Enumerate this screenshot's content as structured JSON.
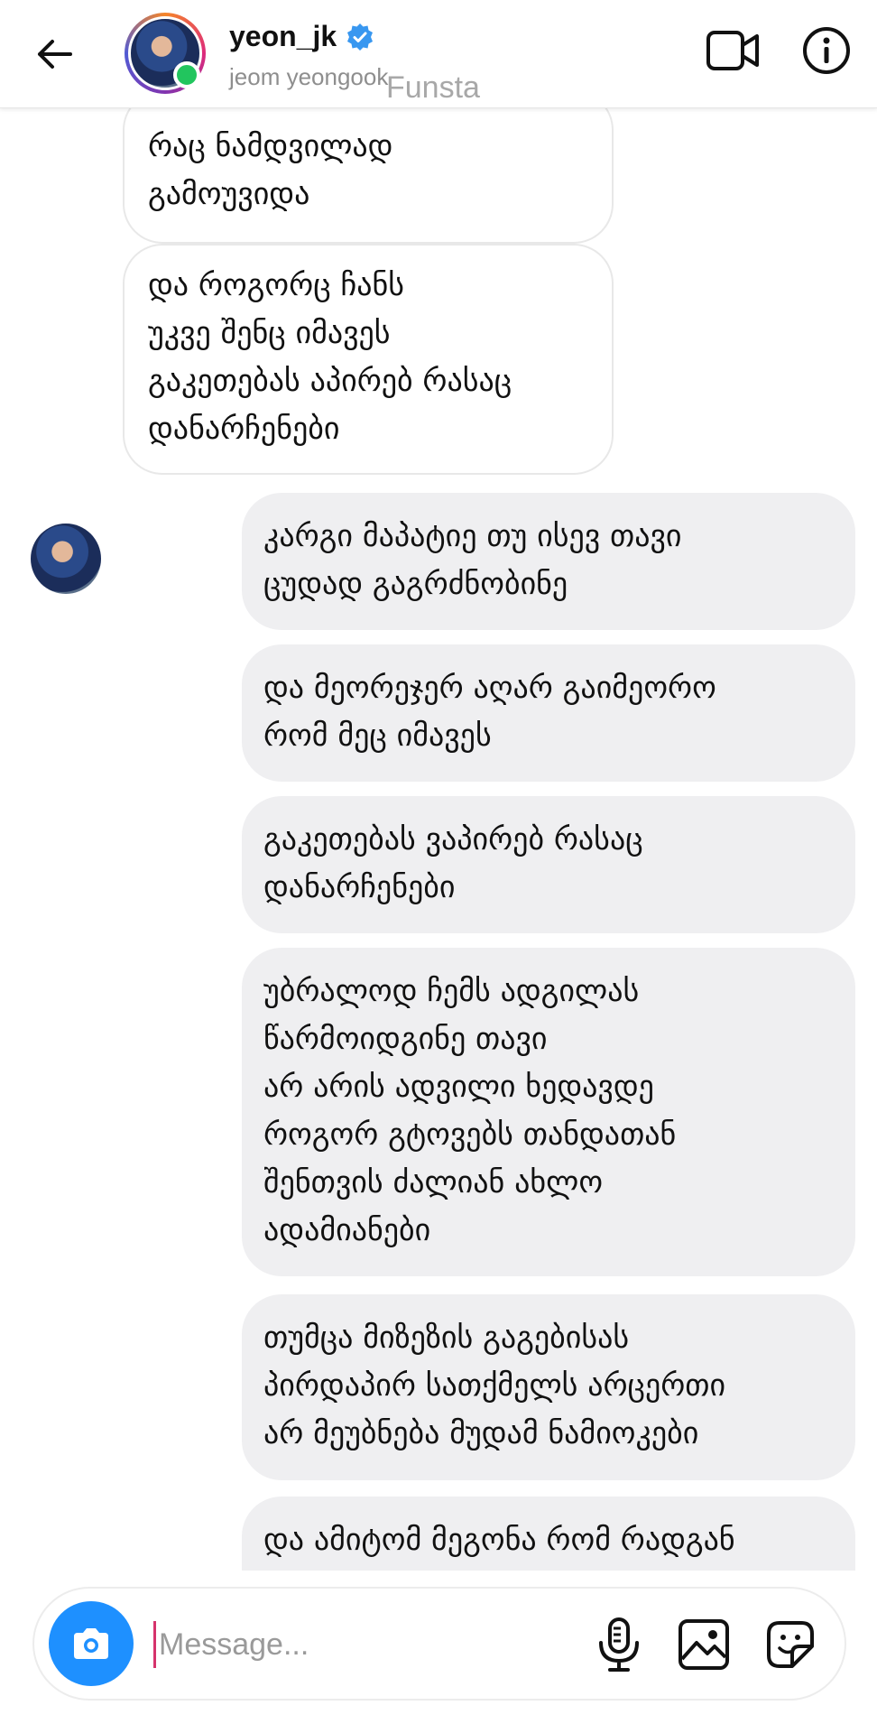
{
  "header": {
    "username": "yeon_jk",
    "subname": "jeom yeongook",
    "watermark": "Funsta",
    "icons": [
      "back-arrow-icon",
      "verified-badge-icon",
      "video-call-icon",
      "info-icon"
    ]
  },
  "messages": [
    {
      "side": "incoming",
      "text": "რაც ნამდვილად\nგამოუვიდა"
    },
    {
      "side": "incoming",
      "text": "და როგორც ჩანს\nუკვე შენც იმავეს\nგაკეთებას აპირებ რასაც\nდანარჩენები"
    },
    {
      "side": "outgoing",
      "text": "კარგი მაპატიე თუ ისევ თავი\nცუდად გაგრძნობინე"
    },
    {
      "side": "outgoing",
      "text": "და მეორეჯერ აღარ გაიმეორო\nრომ მეც იმავეს"
    },
    {
      "side": "outgoing",
      "text": "გაკეთებას ვაპირებ რასაც\nდანარჩენები"
    },
    {
      "side": "outgoing",
      "text": "უბრალოდ ჩემს ადგილას\nწარმოიდგინე თავი\nარ არის ადვილი ხედავდე\nროგორ გტოვებს თანდათან\nშენთვის ძალიან ახლო\nადამიანები"
    },
    {
      "side": "outgoing",
      "text": "თუმცა მიზეზის გაგებისას\nპირდაპირ სათქმელს არცერთი\nარ მეუბნება მუდამ ნამიოკები"
    },
    {
      "side": "outgoing",
      "text": "და ამიტომ მეგონა რომ რადგან"
    }
  ],
  "composer": {
    "placeholder": "Message...",
    "value": "",
    "icons": [
      "camera-icon",
      "microphone-icon",
      "gallery-icon",
      "sticker-icon"
    ]
  },
  "colors": {
    "accent": "#1e90ff",
    "online": "#22c55e",
    "outgoing_bubble": "#efeff1",
    "verified": "#3897f0"
  }
}
